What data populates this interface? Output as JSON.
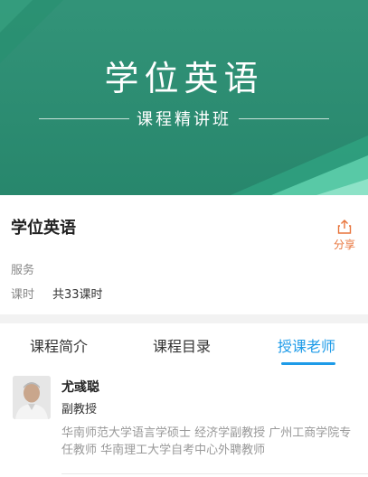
{
  "banner": {
    "title": "学位英语",
    "subtitle": "课程精讲班"
  },
  "course": {
    "title": "学位英语",
    "share_label": "分享",
    "service_label": "服务",
    "hours_label": "课时",
    "hours_value": "共33课时"
  },
  "tabs": [
    {
      "label": "课程简介",
      "active": false
    },
    {
      "label": "课程目录",
      "active": false
    },
    {
      "label": "授课老师",
      "active": true
    }
  ],
  "teacher": {
    "name": "尤彧聪",
    "title": "副教授",
    "description": "华南师范大学语言学硕士 经济学副教授 广州工商学院专任教师 华南理工大学自考中心外聘教师"
  },
  "colors": {
    "banner_green": "#2a8f73",
    "accent_blue": "#1e9be8",
    "share_orange": "#e8743b"
  }
}
